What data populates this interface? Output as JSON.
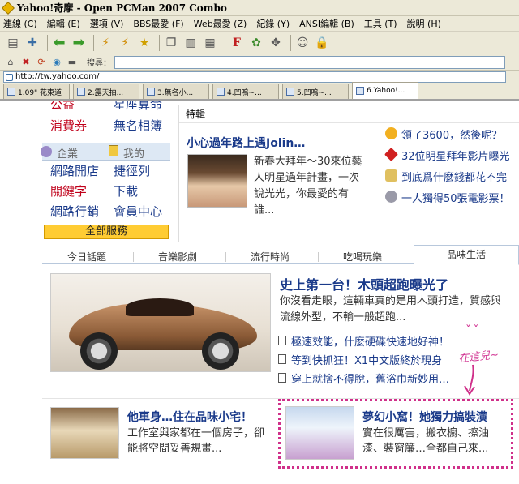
{
  "window": {
    "title": "Yahoo!奇摩 - Open PCMan 2007 Combo"
  },
  "menu": [
    "連線 (C)",
    "編輯 (E)",
    "選項 (V)",
    "BBS最愛 (F)",
    "Web最愛 (Z)",
    "紀錄 (Y)",
    "ANSI編輯 (B)",
    "工具 (T)",
    "說明 (H)"
  ],
  "search": {
    "label": "搜尋："
  },
  "address": {
    "url": "http://tw.yahoo.com/"
  },
  "page_tabs": [
    "1.09\" 花東道",
    "2.露天拍...",
    "3.無名小...",
    "4.凹嗚~...",
    "5.凹嗚~...",
    "6.Yahoo!..."
  ],
  "left_nav": {
    "row_top": [
      "公益",
      "星座算命"
    ],
    "row1": [
      "消費券",
      "無名相簿"
    ],
    "bar": [
      "企業",
      "我的"
    ],
    "row2": [
      "網路開店",
      "捷徑列"
    ],
    "row3": [
      "關鍵字",
      "下載"
    ],
    "row4": [
      "網路行銷",
      "會員中心"
    ],
    "all_services": "全部服務"
  },
  "feature": {
    "header": "特輯",
    "title": "小心過年路上遇Jolin…",
    "desc": "新春大拜年～30來位藝人明星過年計畫，一次說光光，你最愛的有誰...",
    "links": [
      "領了3600，然後呢？",
      "32位明星拜年影片曝光",
      "到底爲什麼錢都花不完",
      "一人獨得50張電影票！"
    ]
  },
  "section_tabs": [
    "今日話題",
    "音樂影劇",
    "流行時尚",
    "吃喝玩樂",
    "品味生活"
  ],
  "headline": {
    "title": "史上第一台！木頭超跑曝光了",
    "desc": "你沒看走眼，這輛車真的是用木頭打造，質感與流線外型，不輸一般超跑...",
    "links": [
      "極速效能，什麼硬碟快速地好神！",
      "等到快抓狂！X1中文版終於現身",
      "穿上就捨不得脫，舊浴巾新妙用…"
    ]
  },
  "annotation": {
    "face": "ˇ  ˇ",
    "text": "在這兒~"
  },
  "teasers": [
    {
      "title": "他車身…住在品味小宅！",
      "desc": "工作室與家都在一個房子，卻能將空間妥善規畫..."
    },
    {
      "title": "夢幻小窩！她獨力搞裝潢",
      "desc": "實在很厲害，搬衣櫥、擦油漆、裝窗簾…全都自己來..."
    }
  ]
}
